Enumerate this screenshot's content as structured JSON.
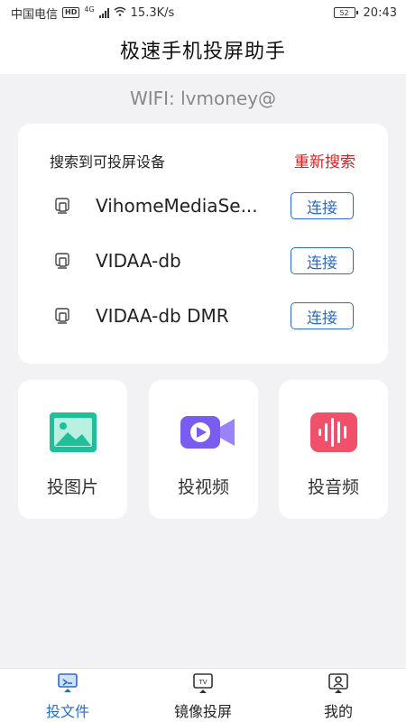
{
  "status_bar": {
    "carrier": "中国电信",
    "hd_badge": "HD",
    "network_type": "4G",
    "speed": "15.3K/s",
    "battery_level": "52",
    "time": "20:43"
  },
  "app": {
    "title": "极速手机投屏助手"
  },
  "wifi": {
    "text": "WIFI: lvmoney@"
  },
  "devices": {
    "header": "搜索到可投屏设备",
    "rescan_label": "重新搜索",
    "items": [
      {
        "name": "VihomeMediaSe...",
        "action": "连接"
      },
      {
        "name": "VIDAA-db",
        "action": "连接"
      },
      {
        "name": "VIDAA-db DMR",
        "action": "连接"
      }
    ]
  },
  "tiles": [
    {
      "label": "投图片",
      "icon": "image-icon",
      "color": "#1fbf9a"
    },
    {
      "label": "投视频",
      "icon": "video-camera-icon",
      "color": "#7b5cf0"
    },
    {
      "label": "投音频",
      "icon": "audio-wave-icon",
      "color": "#f0506a"
    }
  ],
  "bottom_nav": {
    "items": [
      {
        "label": "投文件",
        "icon": "cast-file-icon",
        "active": true
      },
      {
        "label": "镜像投屏",
        "icon": "tv-icon",
        "active": false
      },
      {
        "label": "我的",
        "icon": "profile-icon",
        "active": false
      }
    ]
  },
  "colors": {
    "accent": "#2a6bc8",
    "rescan": "#d92020",
    "background": "#f2f2f4"
  }
}
